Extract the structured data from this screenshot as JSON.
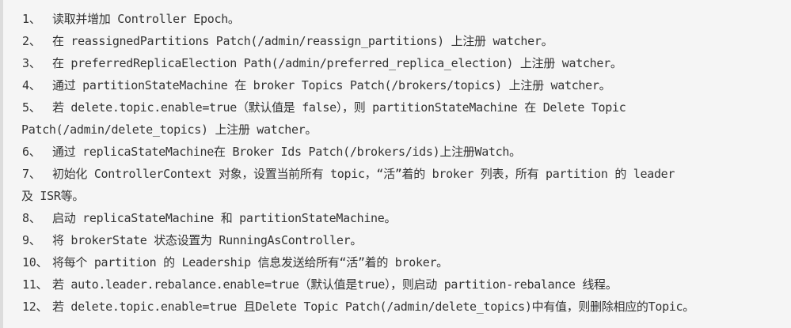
{
  "steps": [
    {
      "num": "1、",
      "text": "读取并增加 Controller Epoch。"
    },
    {
      "num": "2、",
      "text": "在 reassignedPartitions Patch(/admin/reassign_partitions) 上注册 watcher。"
    },
    {
      "num": "3、",
      "text": "在 preferredReplicaElection Path(/admin/preferred_replica_election) 上注册 watcher。"
    },
    {
      "num": "4、",
      "text": "通过 partitionStateMachine 在 broker Topics Patch(/brokers/topics) 上注册 watcher。"
    },
    {
      "num": "5、",
      "text": "若 delete.topic.enable=true（默认值是 false），则 partitionStateMachine 在 Delete Topic",
      "cont": "Patch(/admin/delete_topics) 上注册 watcher。"
    },
    {
      "num": "6、",
      "text": "通过 replicaStateMachine在 Broker Ids Patch(/brokers/ids)上注册Watch。"
    },
    {
      "num": "7、",
      "text": "初始化 ControllerContext 对象，设置当前所有 topic，“活”着的 broker 列表，所有 partition 的 leader",
      "cont": "及 ISR等。"
    },
    {
      "num": "8、",
      "text": "启动 replicaStateMachine 和 partitionStateMachine。"
    },
    {
      "num": "9、",
      "text": "将 brokerState 状态设置为 RunningAsController。"
    },
    {
      "num": "10、",
      "text": "将每个 partition 的 Leadership 信息发送给所有“活”着的 broker。"
    },
    {
      "num": "11、",
      "text": "若 auto.leader.rebalance.enable=true（默认值是true），则启动 partition-rebalance 线程。"
    },
    {
      "num": "12、",
      "text": "若 delete.topic.enable=true 且Delete Topic Patch(/admin/delete_topics)中有值，则删除相应的Topic。"
    }
  ]
}
